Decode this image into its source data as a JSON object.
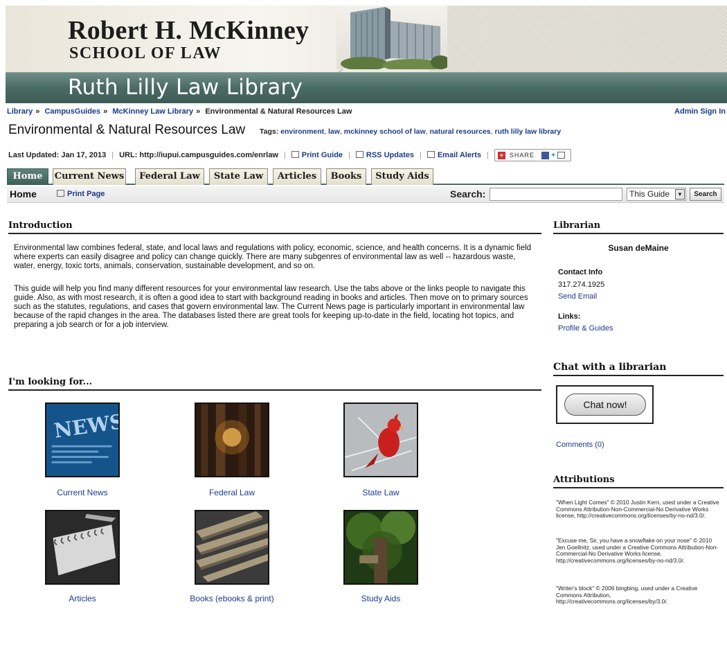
{
  "header": {
    "school_name": "Robert H. McKinney",
    "school_sub": "SCHOOL OF LAW",
    "library_name": "Ruth Lilly Law Library"
  },
  "breadcrumb": {
    "items": [
      "Library",
      "CampusGuides",
      "McKinney Law Library",
      "Environmental & Natural Resources Law"
    ],
    "separator": "»"
  },
  "admin_signin": "Admin Sign In",
  "guide": {
    "title": "Environmental & Natural Resources Law",
    "tags_label": "Tags:",
    "tags": [
      "environment",
      "law",
      "mckinney school of law",
      "natural resources",
      "ruth lilly law library"
    ]
  },
  "meta": {
    "last_updated": "Last Updated: Jan 17, 2013",
    "url": "URL: http://iupui.campusguides.com/enrlaw",
    "print_guide": "Print Guide",
    "rss": "RSS Updates",
    "email": "Email Alerts",
    "share": "SHARE"
  },
  "tabs": [
    {
      "label": "Home",
      "active": true
    },
    {
      "label": "Current News"
    },
    {
      "label": "Federal Law"
    },
    {
      "label": "State Law"
    },
    {
      "label": "Articles"
    },
    {
      "label": "Books"
    },
    {
      "label": "Study Aids"
    }
  ],
  "subbar": {
    "page_name": "Home",
    "print_page": "Print Page",
    "search_label": "Search:",
    "search_value": "",
    "scope": "This Guide",
    "search_button": "Search"
  },
  "intro": {
    "title": "Introduction",
    "para1": "Environmental law combines federal, state, and local laws and regulations with policy, economic, science, and health concerns. It is a dynamic field where experts can easily disagree and policy can change quickly. There are many subgenres of environmental law as well -- hazardous waste, water, energy, toxic torts, animals, conservation, sustainable development, and so on.",
    "para2": "This guide will help you find many different resources for your environmental law research.  Use the tabs above or the links people to navigate this guide. Also, as with most research, it is often a good idea to start with background reading in books and articles. Then move on to primary sources such as the statutes, regulations, and cases that govern environmental law. The Current News page is particularly important in environmental law because of the rapid changes in the area. The databases listed there are great tools for keeping up-to-date in the field, locating hot topics, and preparing a job search or for a job interview."
  },
  "looking": {
    "title": "I'm looking for...",
    "items": [
      "Current News",
      "Federal Law",
      "State Law",
      "Articles",
      "Books (ebooks & print)",
      "Study Aids"
    ]
  },
  "librarian": {
    "title": "Librarian",
    "name": "Susan deMaine",
    "contact_label": "Contact Info",
    "phone": "317.274.1925",
    "send_email": "Send Email",
    "links_label": "Links:",
    "profile": "Profile & Guides"
  },
  "chat": {
    "title": "Chat with a librarian",
    "button": "Chat now!",
    "comments": "Comments (0)"
  },
  "attributions": {
    "title": "Attributions",
    "items": [
      "\"When Light Comes\" © 2010 Justin Kern, used under a Creative Commons Attribution-Non-Commercial-No Derivative Works license, http://creativecommons.org/licenses/by-no-nd/3.0/.",
      "\"Excuse me, Sir, you have a snowflake on your nose\" © 2010 Jen Goellnitz, used under a Creative Commons Attribution-Non-Commercial-No Derivative Works license, http://creativecommons.org/licenses/by-no-nd/3.0/.",
      "\"Writer's block\" © 2006 bingbing, used under a Creative Commons Attribution, http://creativecommons.org/licenses/by/3.0/."
    ]
  },
  "colors": {
    "link": "#1a3a8a",
    "tab_active": "#4c6d66",
    "banner_bar": "#4a6b64"
  }
}
